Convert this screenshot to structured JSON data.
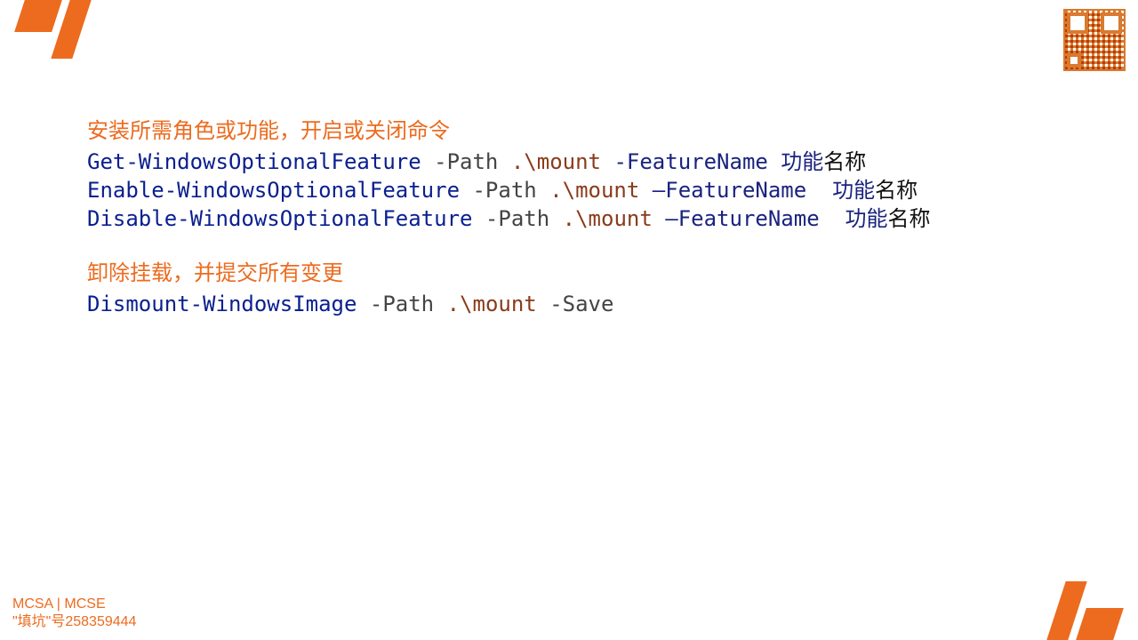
{
  "decor": {
    "accent": "#ec6b1f"
  },
  "section1": {
    "heading": "安装所需角色或功能，开启或关闭命令",
    "lines": [
      {
        "cmd": "Get-WindowsOptionalFeature",
        "flag1": " -Path ",
        "path": ".\\mount",
        "flag2": " -FeatureName ",
        "arg_blue": "功能",
        "arg_black": "名称"
      },
      {
        "cmd": "Enable-WindowsOptionalFeature",
        "flag1": " -Path ",
        "path": ".\\mount",
        "flag2": " –FeatureName ",
        "arg_blue": " 功能",
        "arg_black": "名称"
      },
      {
        "cmd": "Disable-WindowsOptionalFeature",
        "flag1": " -Path ",
        "path": ".\\mount",
        "flag2": " –FeatureName ",
        "arg_blue": " 功能",
        "arg_black": "名称"
      }
    ]
  },
  "section2": {
    "heading": "卸除挂载，并提交所有变更",
    "line": {
      "cmd": "Dismount-WindowsImage",
      "flag1": " -Path ",
      "path": ".\\mount",
      "flag2": " -Save"
    }
  },
  "footer": {
    "line1": "MCSA | MCSE",
    "line2": "\"填坑\"号258359444"
  }
}
